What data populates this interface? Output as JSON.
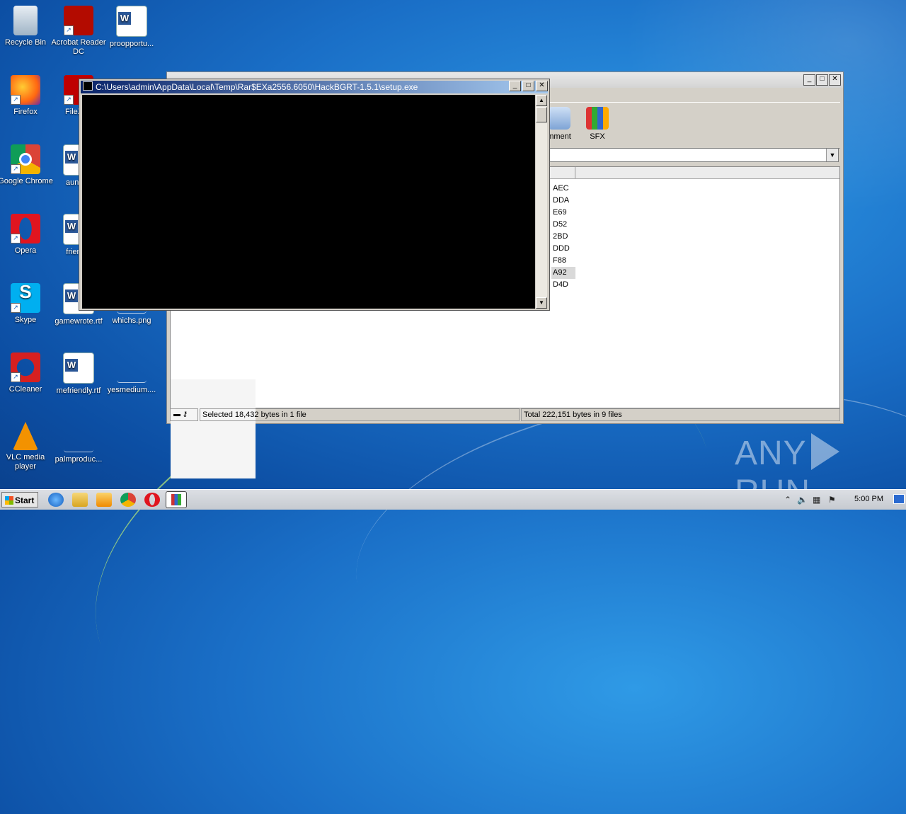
{
  "desktop": {
    "icons": [
      {
        "label": "Recycle Bin"
      },
      {
        "label": "Acrobat Reader DC"
      },
      {
        "label": "proopportu..."
      },
      {
        "label": "Firefox"
      },
      {
        "label": "FileZilla"
      },
      {
        "label": "Google Chrome"
      },
      {
        "label": "aunove"
      },
      {
        "label": "Opera"
      },
      {
        "label": "friendly"
      },
      {
        "label": "Skype"
      },
      {
        "label": "gamewrote.rtf"
      },
      {
        "label": "whichs.png"
      },
      {
        "label": "CCleaner"
      },
      {
        "label": "mefriendly.rtf"
      },
      {
        "label": "yesmedium...."
      },
      {
        "label": "VLC media player"
      },
      {
        "label": "palmproduc..."
      }
    ]
  },
  "winrar": {
    "toolbar": {
      "comment_label": "mment",
      "sfx_label": "SFX"
    },
    "crc_values": [
      "AEC",
      "DDA",
      "E69",
      "D52",
      "2BD",
      "DDD",
      "F88",
      "A92",
      "D4D"
    ],
    "selected_index": 7,
    "status": {
      "selected": "Selected 18,432 bytes in 1 file",
      "total": "Total 222,151 bytes in 9 files"
    }
  },
  "console": {
    "title": "C:\\Users\\admin\\AppData\\Local\\Temp\\Rar$EXa2556.6050\\HackBGRT-1.5.1\\setup.exe"
  },
  "taskbar": {
    "start_label": "Start",
    "clock": "5:00 PM"
  },
  "watermark": {
    "left": "ANY",
    "right": "RUN"
  }
}
